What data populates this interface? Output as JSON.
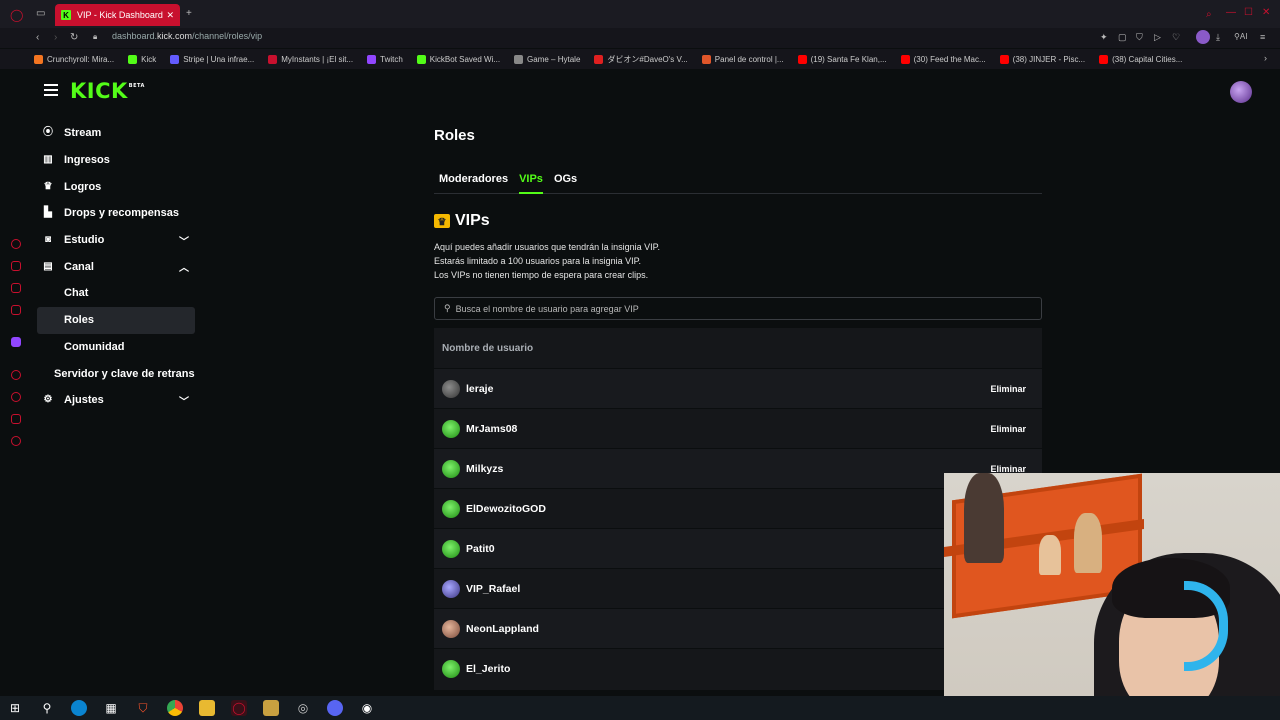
{
  "browser": {
    "tab_title": "VIP - Kick Dashboard",
    "url_prefix": "dashboard.",
    "url_domain": "kick.com",
    "url_path": "/channel/roles/vip",
    "bookmarks": [
      {
        "label": "Crunchyroll: Mira...",
        "color": "#f47521"
      },
      {
        "label": "Kick",
        "color": "#53fc18"
      },
      {
        "label": "Stripe | Una infrae...",
        "color": "#635bff"
      },
      {
        "label": "MyInstants | ¡El sit...",
        "color": "#c8102e"
      },
      {
        "label": "Twitch",
        "color": "#9146ff"
      },
      {
        "label": "KickBot Saved Wi...",
        "color": "#53fc18"
      },
      {
        "label": "Game – Hytale",
        "color": "#888888"
      },
      {
        "label": "ダビオン#DaveO's V...",
        "color": "#e02020"
      },
      {
        "label": "Panel de control |...",
        "color": "#e0562a"
      },
      {
        "label": "(19) Santa Fe Klan,...",
        "color": "#ff0000"
      },
      {
        "label": "(30) Feed the Mac...",
        "color": "#ff0000"
      },
      {
        "label": "(38) JINJER - Pisc...",
        "color": "#ff0000"
      },
      {
        "label": "(38) Capital Cities...",
        "color": "#ff0000"
      }
    ]
  },
  "header": {
    "logo": "KICK",
    "logo_badge": "BETA"
  },
  "nav": {
    "items": [
      {
        "label": "Stream",
        "icon": "stream-icon"
      },
      {
        "label": "Ingresos",
        "icon": "chart-icon"
      },
      {
        "label": "Logros",
        "icon": "trophy-icon"
      },
      {
        "label": "Drops y recompensas",
        "icon": "gift-icon"
      },
      {
        "label": "Estudio",
        "icon": "camera-icon"
      },
      {
        "label": "Canal",
        "icon": "channel-icon"
      },
      {
        "label": "Chat"
      },
      {
        "label": "Roles"
      },
      {
        "label": "Comunidad"
      },
      {
        "label": "Servidor y clave de retrans"
      },
      {
        "label": "Ajustes",
        "icon": "gear-icon"
      }
    ]
  },
  "main": {
    "title": "Roles",
    "tabs": [
      "Moderadores",
      "VIPs",
      "OGs"
    ],
    "active_tab": "VIPs",
    "section_title": "VIPs",
    "description": [
      "Aquí puedes añadir usuarios que tendrán la insignia VIP.",
      "Estarás limitado a 100 usuarios para la insignia VIP.",
      "Los VIPs no tienen tiempo de espera para crear clips."
    ],
    "search_placeholder": "Busca el nombre de usuario para agregar VIP",
    "table_header": "Nombre de usuario",
    "remove_label": "Eliminar",
    "users": [
      "leraje",
      "MrJams08",
      "Milkyzs",
      "ElDewozitoGOD",
      "Patit0",
      "VIP_Rafael",
      "NeonLappland",
      "El_Jerito"
    ]
  },
  "colors": {
    "accent": "#53fc18",
    "background": "#0b0e0f",
    "opera_red": "#c8102e"
  }
}
